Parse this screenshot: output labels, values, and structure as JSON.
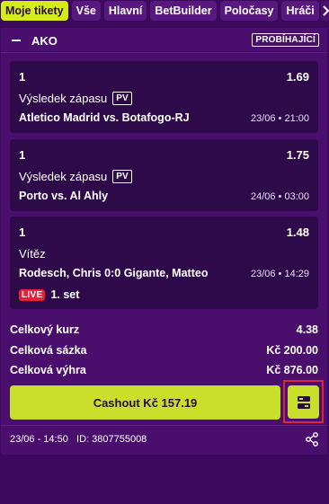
{
  "tabs": [
    {
      "label": "Moje tikety",
      "active": true
    },
    {
      "label": "Vše",
      "active": false
    },
    {
      "label": "Hlavní",
      "active": false
    },
    {
      "label": "BetBuilder",
      "active": false
    },
    {
      "label": "Poločasy",
      "active": false
    },
    {
      "label": "Hráči",
      "active": false
    }
  ],
  "tab_next_icon": "chevron-right-icon",
  "ticket": {
    "collapse_icon": "minus-icon",
    "type": "AKO",
    "status": "PROBÍHAJÍCÍ",
    "selections": [
      {
        "outcome": "1",
        "odds": "1.69",
        "market": "Výsledek zápasu",
        "badge": "PV",
        "event": "Atletico Madrid vs. Botafogo-RJ",
        "datetime": "23/06 • 21:00"
      },
      {
        "outcome": "1",
        "odds": "1.75",
        "market": "Výsledek zápasu",
        "badge": "PV",
        "event": "Porto vs. Al Ahly",
        "datetime": "24/06 • 03:00"
      },
      {
        "outcome": "1",
        "odds": "1.48",
        "market": "Vítěz",
        "event": "Rodesch, Chris 0:0 Gigante, Matteo",
        "datetime": "23/06 • 14:29",
        "live_badge": "LIVE",
        "live_text": "1. set"
      }
    ],
    "summary": {
      "total_odds_label": "Celkový kurz",
      "total_odds_value": "4.38",
      "stake_label": "Celková sázka",
      "stake_value": "Kč 200.00",
      "win_label": "Celková výhra",
      "win_value": "Kč 876.00"
    },
    "cashout_label": "Cashout Kč 157.19",
    "cashout_settings_icon": "cashout-settings-icon",
    "footer": {
      "date": "23/06 - 14:50",
      "id": "ID: 3807755008",
      "share_icon": "share-icon"
    }
  },
  "colors": {
    "background": "#3b0a5c",
    "card": "#4a0f6d",
    "selection": "#2e0a4a",
    "accent": "#c8df2b",
    "live": "#e5213a"
  }
}
